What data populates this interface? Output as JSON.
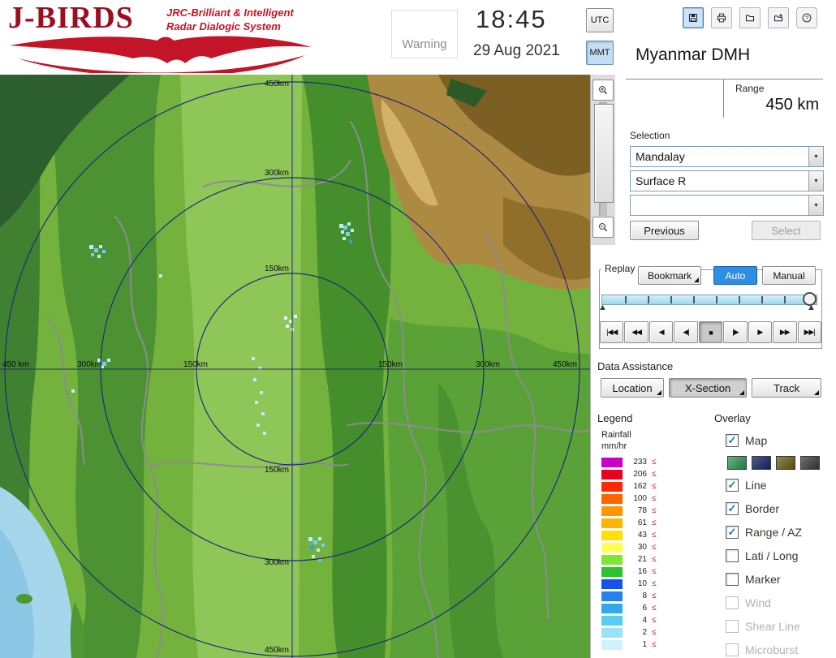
{
  "header": {
    "logo": {
      "title": "J-BIRDS",
      "subtitle_line1": "JRC-Brilliant & Intelligent",
      "subtitle_line2": "Radar  Dialogic  System"
    },
    "warning_label": "Warning",
    "clock": {
      "time": "18:45",
      "date": "29 Aug 2021"
    },
    "timezone": {
      "utc": "UTC",
      "mmt": "MMT",
      "selected": "MMT"
    },
    "station_name": "Myanmar DMH",
    "toolbar_icons": [
      "save-icon",
      "print-icon",
      "open-folder-icon",
      "import-icon",
      "help-icon"
    ],
    "help_glyph": "?"
  },
  "map": {
    "vlabels": [
      "450km",
      "300km",
      "150km",
      "150km",
      "300km",
      "450km"
    ],
    "hlabels": [
      "450 km",
      "300km",
      "150km",
      "150km",
      "300km",
      "450km"
    ],
    "ring_color": "#232a78"
  },
  "panel": {
    "range": {
      "label": "Range",
      "value": "450 km"
    },
    "selection": {
      "label": "Selection",
      "dropdowns": [
        {
          "value": "Mandalay"
        },
        {
          "value": "Surface R"
        },
        {
          "value": ""
        }
      ],
      "previous_label": "Previous",
      "select_label": "Select",
      "select_enabled": false
    },
    "replay": {
      "label": "Replay",
      "bookmark_label": "Bookmark",
      "auto_label": "Auto",
      "manual_label": "Manual",
      "active_mode": "Auto",
      "playback_icons": [
        "|◀◀",
        "◀◀",
        "◀",
        "◀|",
        "■",
        "|▶",
        "▶",
        "▶▶",
        "▶▶|"
      ],
      "playback_names": [
        "skip-to-start",
        "fast-rewind",
        "play-reverse",
        "step-back",
        "stop",
        "step-forward",
        "play",
        "fast-forward",
        "skip-to-end"
      ],
      "active_index": 4
    },
    "data_assistance": {
      "label": "Data Assistance",
      "buttons": [
        {
          "label": "Location",
          "pressed": false
        },
        {
          "label": "X-Section",
          "pressed": true
        },
        {
          "label": "Track",
          "pressed": false
        }
      ]
    },
    "legend": {
      "label": "Legend",
      "unit_line1": "Rainfall",
      "unit_line2": "mm/hr",
      "symbol": "≤",
      "entries": [
        {
          "value": "233",
          "color": "#c800c8"
        },
        {
          "value": "206",
          "color": "#e8001e"
        },
        {
          "value": "162",
          "color": "#ff2800"
        },
        {
          "value": "100",
          "color": "#ff6400"
        },
        {
          "value": "78",
          "color": "#ff9600"
        },
        {
          "value": "61",
          "color": "#ffb400"
        },
        {
          "value": "43",
          "color": "#ffe000"
        },
        {
          "value": "30",
          "color": "#ffff54"
        },
        {
          "value": "21",
          "color": "#7ce832"
        },
        {
          "value": "16",
          "color": "#2cc42c"
        },
        {
          "value": "10",
          "color": "#1650ee"
        },
        {
          "value": "8",
          "color": "#2880f0"
        },
        {
          "value": "6",
          "color": "#30a8f0"
        },
        {
          "value": "4",
          "color": "#58ccf4"
        },
        {
          "value": "2",
          "color": "#9ae2f8"
        },
        {
          "value": "1",
          "color": "#cef2fc"
        }
      ]
    },
    "overlay": {
      "label": "Overlay",
      "map_swatches": [
        "#2f9e58",
        "#16266a",
        "#6e6216",
        "#3f3f3f"
      ],
      "items": [
        {
          "label": "Map",
          "checked": true,
          "enabled": true
        },
        {
          "label": "Line",
          "checked": true,
          "enabled": true
        },
        {
          "label": "Border",
          "checked": true,
          "enabled": true
        },
        {
          "label": "Range / AZ",
          "checked": true,
          "enabled": true
        },
        {
          "label": "Lati / Long",
          "checked": false,
          "enabled": true
        },
        {
          "label": "Marker",
          "checked": false,
          "enabled": true
        },
        {
          "label": "Wind",
          "checked": false,
          "enabled": false
        },
        {
          "label": "Shear Line",
          "checked": false,
          "enabled": false
        },
        {
          "label": "Microburst",
          "checked": false,
          "enabled": false
        }
      ]
    }
  },
  "icons": {
    "dropdown_arrow": "▼",
    "check": "✓",
    "slider_marker": "▲"
  }
}
